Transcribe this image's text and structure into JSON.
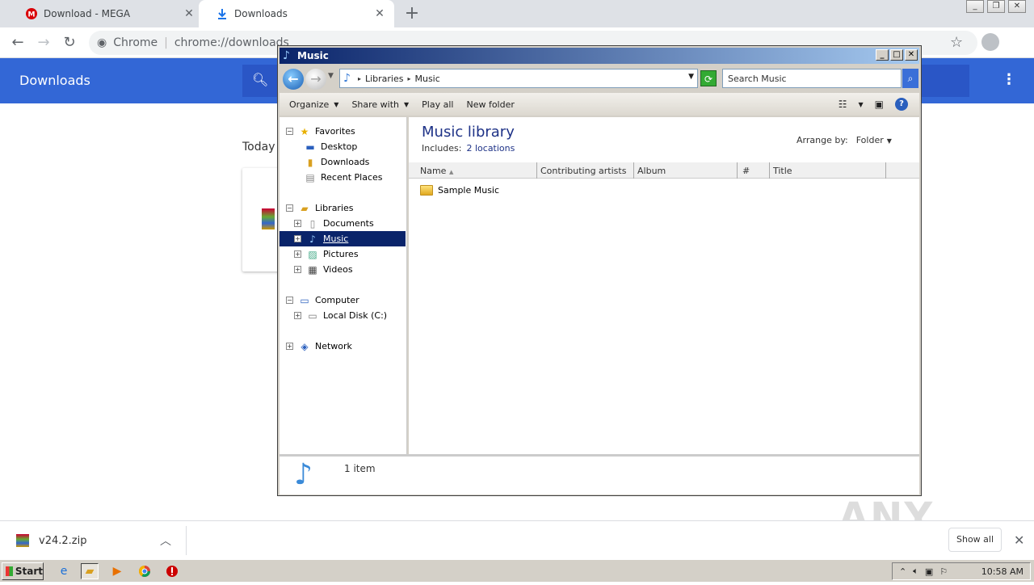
{
  "chrome": {
    "tabs": [
      {
        "title": "Download - MEGA",
        "icon": "mega-icon"
      },
      {
        "title": "Downloads",
        "icon": "download-icon"
      }
    ],
    "new_tab": "+",
    "omnibox": {
      "chip": "Chrome",
      "url": "chrome://downloads"
    },
    "page_title": "Downloads",
    "section": "Today"
  },
  "shelf": {
    "file_name": "v24.2.zip",
    "show_all": "Show all"
  },
  "watermark": "ANY RUN",
  "explorer": {
    "title": "Music",
    "breadcrumb": [
      "Libraries",
      "Music"
    ],
    "search_placeholder": "Search Music",
    "commands": [
      "Organize",
      "Share with",
      "Play all",
      "New folder"
    ],
    "nav": {
      "favorites": "Favorites",
      "desktop": "Desktop",
      "downloads": "Downloads",
      "recent": "Recent Places",
      "libraries": "Libraries",
      "documents": "Documents",
      "music": "Music",
      "pictures": "Pictures",
      "videos": "Videos",
      "computer": "Computer",
      "local_disk": "Local Disk (C:)",
      "network": "Network"
    },
    "library_title": "Music library",
    "includes_label": "Includes:",
    "includes_value": "2 locations",
    "arrange_label": "Arrange by:",
    "arrange_value": "Folder",
    "columns": [
      "Name",
      "Contributing artists",
      "Album",
      "#",
      "Title"
    ],
    "items": [
      "Sample Music"
    ],
    "status_count": "1 item"
  },
  "taskbar": {
    "start": "Start",
    "clock": "10:58 AM"
  }
}
